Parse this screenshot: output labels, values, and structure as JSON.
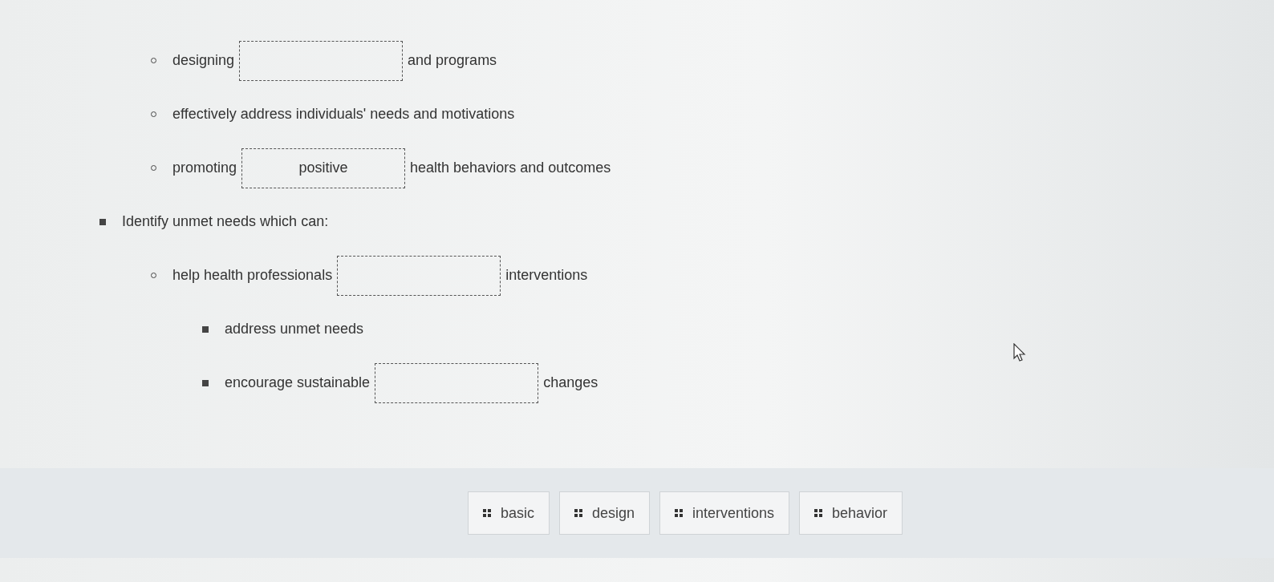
{
  "continued_items": [
    {
      "parts": [
        {
          "kind": "text",
          "text": "designing"
        },
        {
          "kind": "blank"
        },
        {
          "kind": "text",
          "text": "and programs"
        }
      ]
    },
    {
      "parts": [
        {
          "kind": "text",
          "text": "effectively address individuals' needs and motivations"
        }
      ]
    },
    {
      "parts": [
        {
          "kind": "text",
          "text": "promoting"
        },
        {
          "kind": "blank",
          "value": "positive"
        },
        {
          "kind": "text",
          "text": "health behaviors and outcomes"
        }
      ]
    }
  ],
  "items": [
    {
      "parts": [
        {
          "kind": "text",
          "text": "Identify unmet needs which can:"
        }
      ],
      "children": [
        {
          "parts": [
            {
              "kind": "text",
              "text": "help health professionals"
            },
            {
              "kind": "blank"
            },
            {
              "kind": "text",
              "text": "interventions"
            }
          ],
          "children": [
            {
              "parts": [
                {
                  "kind": "text",
                  "text": "address unmet needs"
                }
              ]
            },
            {
              "parts": [
                {
                  "kind": "text",
                  "text": "encourage sustainable"
                },
                {
                  "kind": "blank"
                },
                {
                  "kind": "text",
                  "text": "changes"
                }
              ]
            }
          ]
        }
      ]
    }
  ],
  "bank": [
    {
      "label": "basic"
    },
    {
      "label": "design"
    },
    {
      "label": "interventions"
    },
    {
      "label": "behavior"
    }
  ]
}
